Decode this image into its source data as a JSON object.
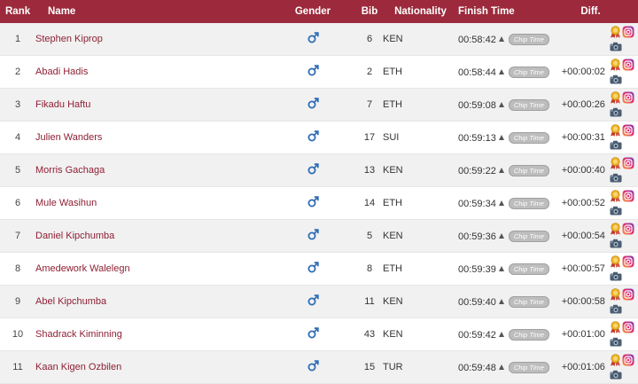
{
  "columns": {
    "rank": "Rank",
    "name": "Name",
    "gender": "Gender",
    "bib": "Bib",
    "nationality": "Nationality",
    "finish_time": "Finish Time",
    "diff": "Diff."
  },
  "chip_label": "Chip Time",
  "icons": {
    "gender": "male-symbol-icon",
    "sort": "triangle-up-icon",
    "award": "medal-ribbon-icon",
    "instagram": "instagram-icon",
    "camera": "camera-icon"
  },
  "colors": {
    "header_bg": "#9c2a3c",
    "name_link": "#8e1f33",
    "gender_icon": "#2f6db5",
    "row_alt": "#f1f1f1"
  },
  "rows": [
    {
      "rank": "1",
      "name": "Stephen Kiprop",
      "bib": "6",
      "nationality": "KEN",
      "finish_time": "00:58:42",
      "diff": ""
    },
    {
      "rank": "2",
      "name": "Abadi Hadis",
      "bib": "2",
      "nationality": "ETH",
      "finish_time": "00:58:44",
      "diff": "+00:00:02"
    },
    {
      "rank": "3",
      "name": "Fikadu Haftu",
      "bib": "7",
      "nationality": "ETH",
      "finish_time": "00:59:08",
      "diff": "+00:00:26"
    },
    {
      "rank": "4",
      "name": "Julien Wanders",
      "bib": "17",
      "nationality": "SUI",
      "finish_time": "00:59:13",
      "diff": "+00:00:31"
    },
    {
      "rank": "5",
      "name": "Morris Gachaga",
      "bib": "13",
      "nationality": "KEN",
      "finish_time": "00:59:22",
      "diff": "+00:00:40"
    },
    {
      "rank": "6",
      "name": "Mule Wasihun",
      "bib": "14",
      "nationality": "ETH",
      "finish_time": "00:59:34",
      "diff": "+00:00:52"
    },
    {
      "rank": "7",
      "name": "Daniel Kipchumba",
      "bib": "5",
      "nationality": "KEN",
      "finish_time": "00:59:36",
      "diff": "+00:00:54"
    },
    {
      "rank": "8",
      "name": "Amedework Walelegn",
      "bib": "8",
      "nationality": "ETH",
      "finish_time": "00:59:39",
      "diff": "+00:00:57"
    },
    {
      "rank": "9",
      "name": "Abel Kipchumba",
      "bib": "11",
      "nationality": "KEN",
      "finish_time": "00:59:40",
      "diff": "+00:00:58"
    },
    {
      "rank": "10",
      "name": "Shadrack Kiminning",
      "bib": "43",
      "nationality": "KEN",
      "finish_time": "00:59:42",
      "diff": "+00:01:00"
    },
    {
      "rank": "11",
      "name": "Kaan Kigen Ozbilen",
      "bib": "15",
      "nationality": "TUR",
      "finish_time": "00:59:48",
      "diff": "+00:01:06"
    }
  ]
}
